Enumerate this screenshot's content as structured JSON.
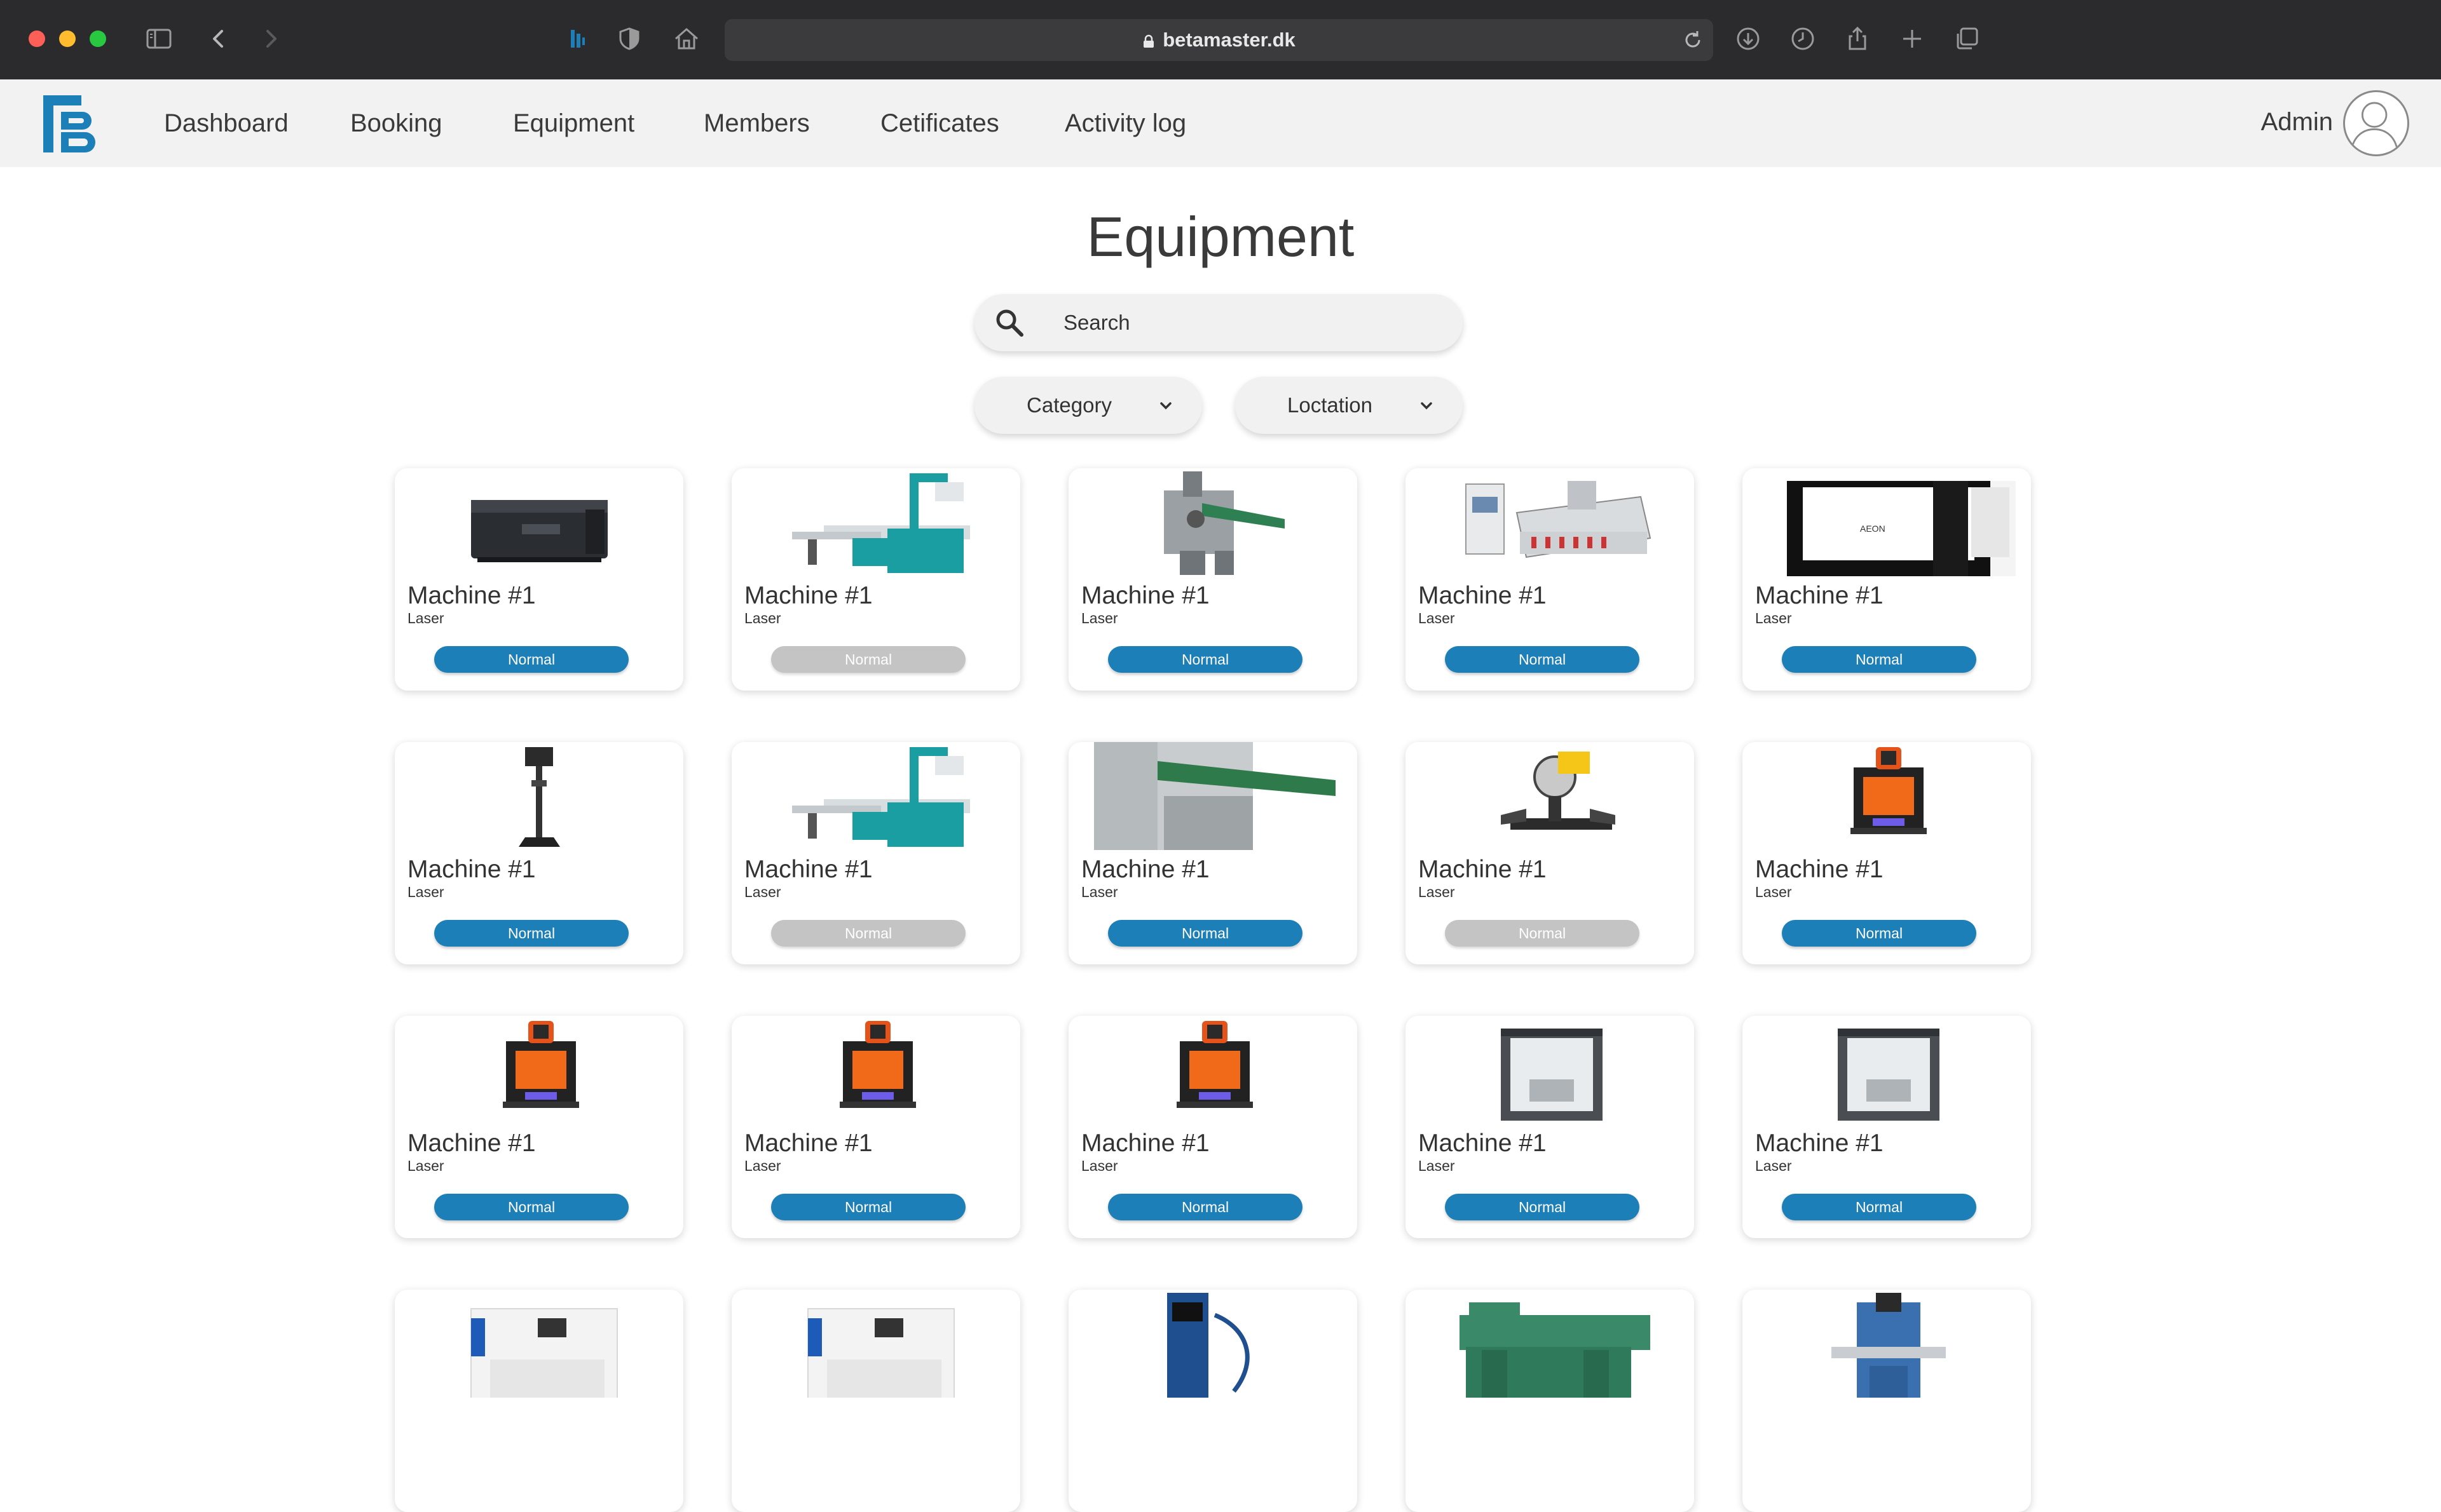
{
  "browser": {
    "url": "betamaster.dk"
  },
  "nav": {
    "items": [
      "Dashboard",
      "Booking",
      "Equipment",
      "Members",
      "Cetificates",
      "Activity log"
    ],
    "user_label": "Admin"
  },
  "page": {
    "title": "Equipment",
    "search_placeholder": "Search",
    "filters": [
      "Category",
      "Loctation"
    ]
  },
  "colors": {
    "status_available": "#1d7fb7",
    "status_unavailable": "#c4c4c4",
    "logo": "#1d7fb7"
  },
  "machines": [
    {
      "name": "Machine #1",
      "category": "Laser",
      "status": "Normal",
      "available": true,
      "image": "laser-cutter-dark"
    },
    {
      "name": "Machine #1",
      "category": "Laser",
      "status": "Normal",
      "available": false,
      "image": "panel-saw-teal"
    },
    {
      "name": "Machine #1",
      "category": "Laser",
      "status": "Normal",
      "available": true,
      "image": "planer-green"
    },
    {
      "name": "Machine #1",
      "category": "Laser",
      "status": "Normal",
      "available": true,
      "image": "cnc-router"
    },
    {
      "name": "Machine #1",
      "category": "Laser",
      "status": "Normal",
      "available": true,
      "image": "laser-cutter-large"
    },
    {
      "name": "Machine #1",
      "category": "Laser",
      "status": "Normal",
      "available": true,
      "image": "drill-press"
    },
    {
      "name": "Machine #1",
      "category": "Laser",
      "status": "Normal",
      "available": false,
      "image": "panel-saw-teal"
    },
    {
      "name": "Machine #1",
      "category": "Laser",
      "status": "Normal",
      "available": true,
      "image": "jointer-green"
    },
    {
      "name": "Machine #1",
      "category": "Laser",
      "status": "Normal",
      "available": false,
      "image": "miter-saw"
    },
    {
      "name": "Machine #1",
      "category": "Laser",
      "status": "Normal",
      "available": true,
      "image": "3d-printer-orange"
    },
    {
      "name": "Machine #1",
      "category": "Laser",
      "status": "Normal",
      "available": true,
      "image": "3d-printer-orange"
    },
    {
      "name": "Machine #1",
      "category": "Laser",
      "status": "Normal",
      "available": true,
      "image": "3d-printer-orange"
    },
    {
      "name": "Machine #1",
      "category": "Laser",
      "status": "Normal",
      "available": true,
      "image": "3d-printer-orange"
    },
    {
      "name": "Machine #1",
      "category": "Laser",
      "status": "Normal",
      "available": true,
      "image": "3d-printer-enclosed"
    },
    {
      "name": "Machine #1",
      "category": "Laser",
      "status": "Normal",
      "available": true,
      "image": "3d-printer-enclosed"
    },
    {
      "name": "",
      "category": "",
      "status": "",
      "available": true,
      "image": "3d-printer-white"
    },
    {
      "name": "",
      "category": "",
      "status": "",
      "available": true,
      "image": "3d-printer-white"
    },
    {
      "name": "",
      "category": "",
      "status": "",
      "available": true,
      "image": "welder-blue"
    },
    {
      "name": "",
      "category": "",
      "status": "",
      "available": true,
      "image": "lathe-green"
    },
    {
      "name": "",
      "category": "",
      "status": "",
      "available": true,
      "image": "milling-machine"
    }
  ]
}
